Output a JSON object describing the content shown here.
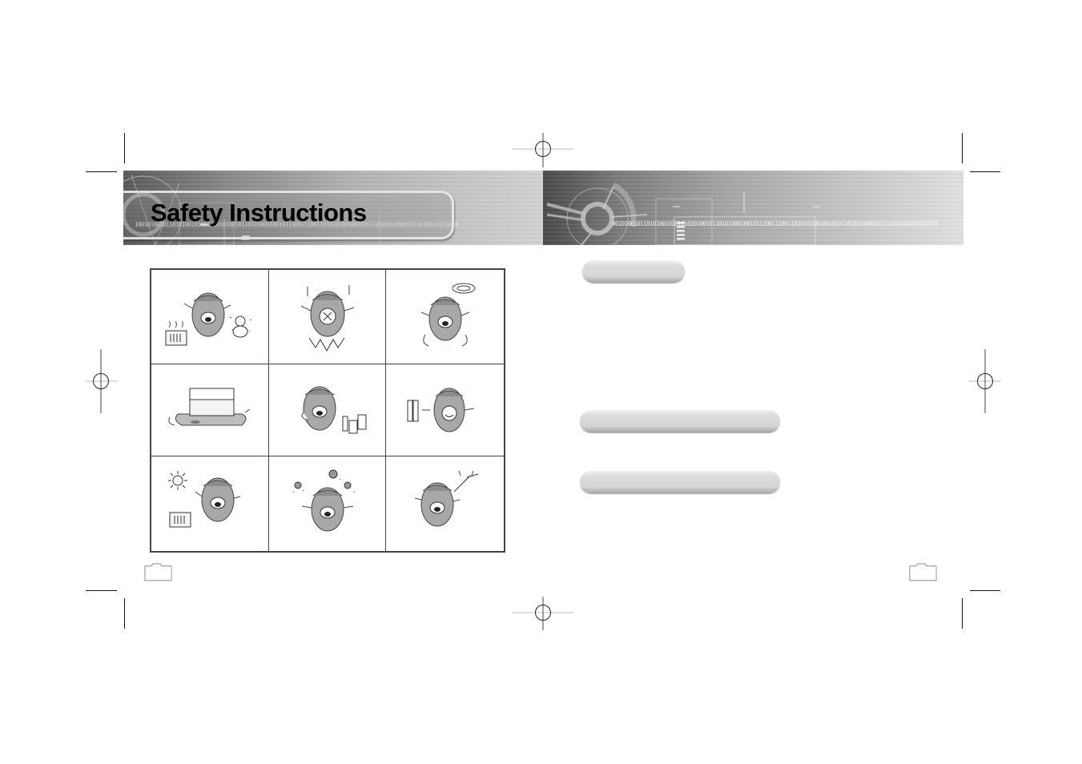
{
  "page": {
    "title": "Safety Instructions",
    "binary_strip": "1001010010110101001010010101010010110101000100101110011100110101010010010101101010100010111010101011010",
    "binary_strip_right": "00101001011010100101010101010010110101000100101110011100110101010010010101101010100010111010101010110101"
  },
  "illustrations": [
    {
      "id": "heat-cold-warning",
      "icon": "player-mascot-with-heater-and-snowman"
    },
    {
      "id": "impact-warning",
      "icon": "player-mascot-dropped-shock"
    },
    {
      "id": "dizzy-drop-warning",
      "icon": "player-mascot-dizzy-spinning"
    },
    {
      "id": "heavy-objects-warning",
      "icon": "player-under-books"
    },
    {
      "id": "chemicals-warning",
      "icon": "player-mascot-with-chemicals"
    },
    {
      "id": "battery-warning",
      "icon": "player-mascot-with-batteries"
    },
    {
      "id": "sunlight-heat-warning",
      "icon": "player-mascot-sun-and-heater"
    },
    {
      "id": "dust-warning",
      "icon": "player-mascot-dust-particles"
    },
    {
      "id": "disassembly-warning",
      "icon": "player-mascot-with-screwdriver"
    }
  ],
  "section_labels": [
    {
      "id": "section-pill-1",
      "label": ""
    },
    {
      "id": "section-pill-2",
      "label": ""
    },
    {
      "id": "section-pill-3",
      "label": ""
    }
  ],
  "page_numbers": {
    "left": "",
    "right": ""
  }
}
